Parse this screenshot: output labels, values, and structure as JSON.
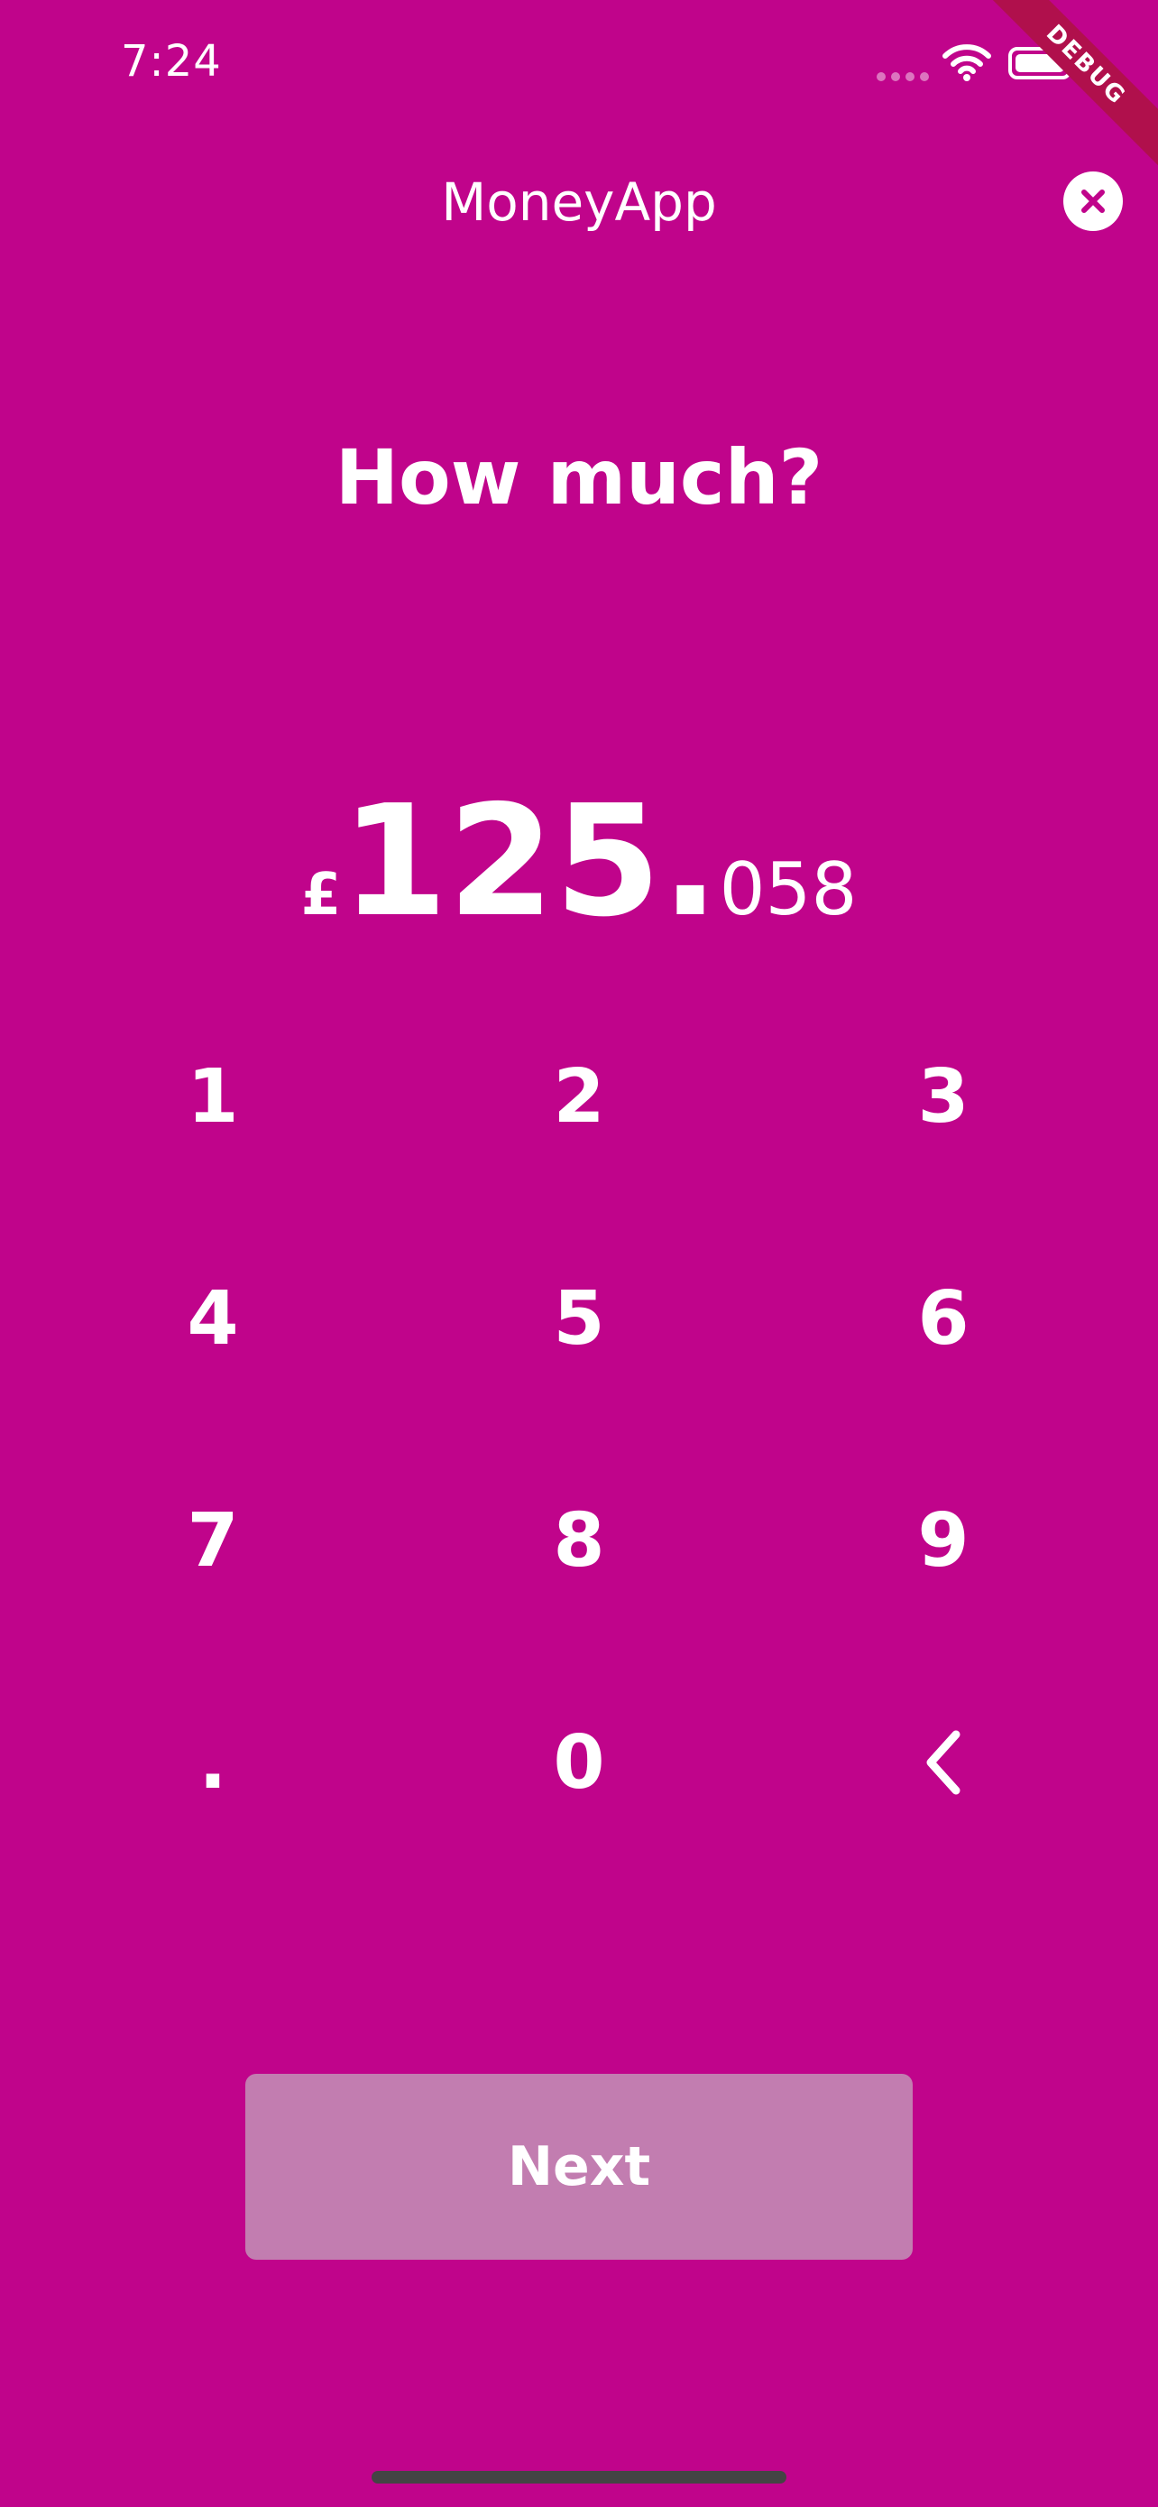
{
  "status_bar": {
    "time": "7:24"
  },
  "debug_banner": "DEBUG",
  "header": {
    "title": "MoneyApp",
    "close_icon": "close-icon"
  },
  "prompt": "How much?",
  "amount": {
    "currency": "£",
    "major": "125.",
    "minor": "058"
  },
  "keypad": {
    "keys": [
      "1",
      "2",
      "3",
      "4",
      "5",
      "6",
      "7",
      "8",
      "9",
      ".",
      "0",
      "backspace-icon"
    ]
  },
  "next_button": {
    "label": "Next"
  },
  "colors": {
    "background": "#c0048b",
    "next_button_bg": "#c27db0",
    "text": "#ffffff"
  }
}
